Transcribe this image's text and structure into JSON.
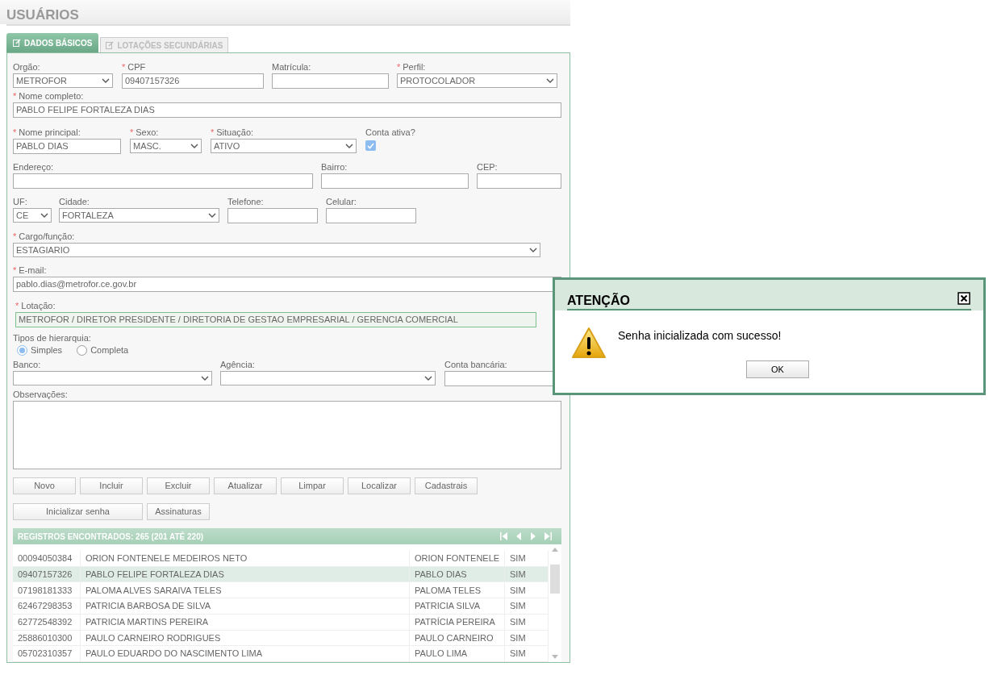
{
  "page_title": "USUÁRIOS",
  "tabs": [
    {
      "label": "DADOS BÁSICOS",
      "selected": true
    },
    {
      "label": "LOTAÇÕES SECUNDÁRIAS",
      "selected": false
    }
  ],
  "form_rows": [
    {
      "fields": [
        {
          "label": "Orgão:",
          "kind": "select",
          "value": "METROFOR"
        },
        {
          "required_mark": "*",
          "label": "CPF",
          "kind": "text",
          "value": "09407157326"
        },
        {
          "label": "Matrícula:",
          "kind": "text"
        },
        {
          "required_mark": "*",
          "label": "Perfil:",
          "kind": "select",
          "value": "PROTOCOLADOR"
        }
      ]
    },
    {
      "fields": [
        {
          "required_mark": "*",
          "label": "Nome completo:",
          "kind": "text",
          "value": "PABLO FELIPE FORTALEZA DIAS"
        }
      ]
    },
    {
      "fields": [
        {
          "required_mark": "*",
          "label": "Nome principal:",
          "kind": "text",
          "value": "PABLO DIAS"
        },
        {
          "required_mark": "*",
          "label": "Sexo:",
          "kind": "select",
          "value": "MASC."
        },
        {
          "required_mark": "*",
          "label": "Situação:",
          "kind": "select",
          "value": "ATIVO"
        },
        {
          "label": "Conta ativa?",
          "kind": "checkbox",
          "checked": true
        }
      ]
    },
    {
      "fields": [
        {
          "label": "Endereço:",
          "kind": "text"
        },
        {
          "label": "Bairro:",
          "kind": "text"
        },
        {
          "label": "CEP:",
          "kind": "text"
        }
      ]
    },
    {
      "fields": [
        {
          "label": "UF:",
          "kind": "select",
          "value": "CE"
        },
        {
          "label": "Cidade:",
          "kind": "select",
          "value": "FORTALEZA"
        },
        {
          "label": "Telefone:",
          "kind": "text"
        },
        {
          "label": "Celular:",
          "kind": "text"
        }
      ]
    },
    {
      "fields": [
        {
          "required_mark": "*",
          "label": "Cargo/função:",
          "kind": "select",
          "value": "ESTAGIARIO"
        }
      ]
    },
    {
      "fields": [
        {
          "required_mark": "*",
          "label": "E-mail:",
          "kind": "text",
          "value": "pablo.dias@metrofor.ce.gov.br"
        }
      ]
    },
    {
      "fields": [
        {
          "required_mark": "*",
          "label": "Lotação:",
          "kind": "readonly",
          "value": "METROFOR / DIRETOR PRESIDENTE / DIRETORIA DE GESTAO EMPRESARIAL / GERENCIA COMERCIAL"
        }
      ]
    }
  ],
  "hierarchy": {
    "label": "Tipos de hierarquia:",
    "options": [
      {
        "label": "Simples",
        "selected": true
      },
      {
        "label": "Completa",
        "selected": false
      }
    ]
  },
  "bank_row": {
    "fields": [
      {
        "label": "Banco:",
        "kind": "select"
      },
      {
        "label": "Agência:",
        "kind": "select"
      },
      {
        "label": "Conta bancária:",
        "kind": "text"
      }
    ]
  },
  "notes": {
    "label": "Observações:"
  },
  "buttons": [
    "Novo",
    "Incluir",
    "Excluir",
    "Atualizar",
    "Limpar",
    "Localizar",
    "Cadastrais"
  ],
  "buttons_2": [
    "Inicializar senha",
    "Assinaturas"
  ],
  "results": {
    "header": "REGISTROS ENCONTRADOS: 265 (201 ATÉ 220)",
    "rows": [
      {
        "cells": [
          "00094050384",
          "ORION FONTENELE MEDEIROS NETO",
          "ORION FONTENELE",
          "SIM"
        ],
        "selected": false
      },
      {
        "cells": [
          "09407157326",
          "PABLO FELIPE FORTALEZA DIAS",
          "PABLO DIAS",
          "SIM"
        ],
        "selected": true
      },
      {
        "cells": [
          "07198181333",
          "PALOMA ALVES SARAIVA TELES",
          "PALOMA TELES",
          "SIM"
        ],
        "selected": false
      },
      {
        "cells": [
          "62467298353",
          "PATRICIA BARBOSA DE SILVA",
          "PATRICIA SILVA",
          "SIM"
        ],
        "selected": false
      },
      {
        "cells": [
          "62772548392",
          "PATRICIA MARTINS PEREIRA",
          "PATRÍCIA PEREIRA",
          "SIM"
        ],
        "selected": false
      },
      {
        "cells": [
          "25886010300",
          "PAULO CARNEIRO RODRIGUES",
          "PAULO CARNEIRO",
          "SIM"
        ],
        "selected": false
      },
      {
        "cells": [
          "05702310357",
          "PAULO EDUARDO DO NASCIMENTO LIMA",
          "PAULO LIMA",
          "SIM"
        ],
        "selected": false
      }
    ]
  },
  "dialog": {
    "title": "ATENÇÃO",
    "message": "Senha inicializada com sucesso!",
    "button": "OK"
  }
}
